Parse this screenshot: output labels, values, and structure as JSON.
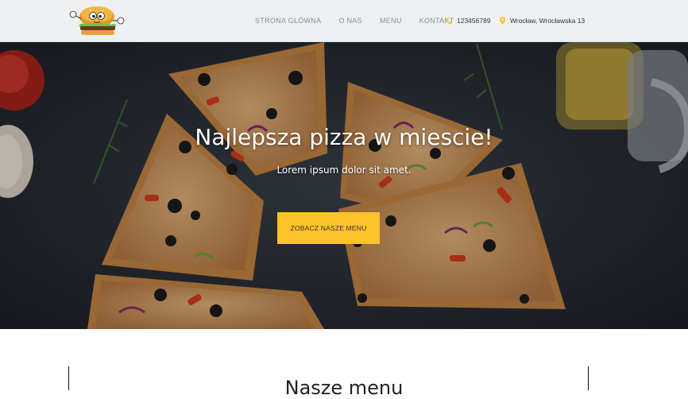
{
  "nav": {
    "links": [
      "STRONA GŁÓWNA",
      "O NAS",
      "MENU",
      "KONTAKT"
    ],
    "phone": "123456789",
    "address": "Wrocław, Wrocławska 13"
  },
  "hero": {
    "title": "Najlepsza pizza w miescie!",
    "subtitle": "Lorem ipsum dolor sit amet.",
    "button_label": "ZOBACZ NASZE MENU"
  },
  "menu_section": {
    "title": "Nasze menu"
  },
  "colors": {
    "accent": "#fec328",
    "navbar_bg": "#eef0f2",
    "hero_dark": "#2a2f37"
  },
  "icons": {
    "logo": "burger-mascot-icon",
    "phone": "phone-icon",
    "address": "map-pin-icon"
  }
}
